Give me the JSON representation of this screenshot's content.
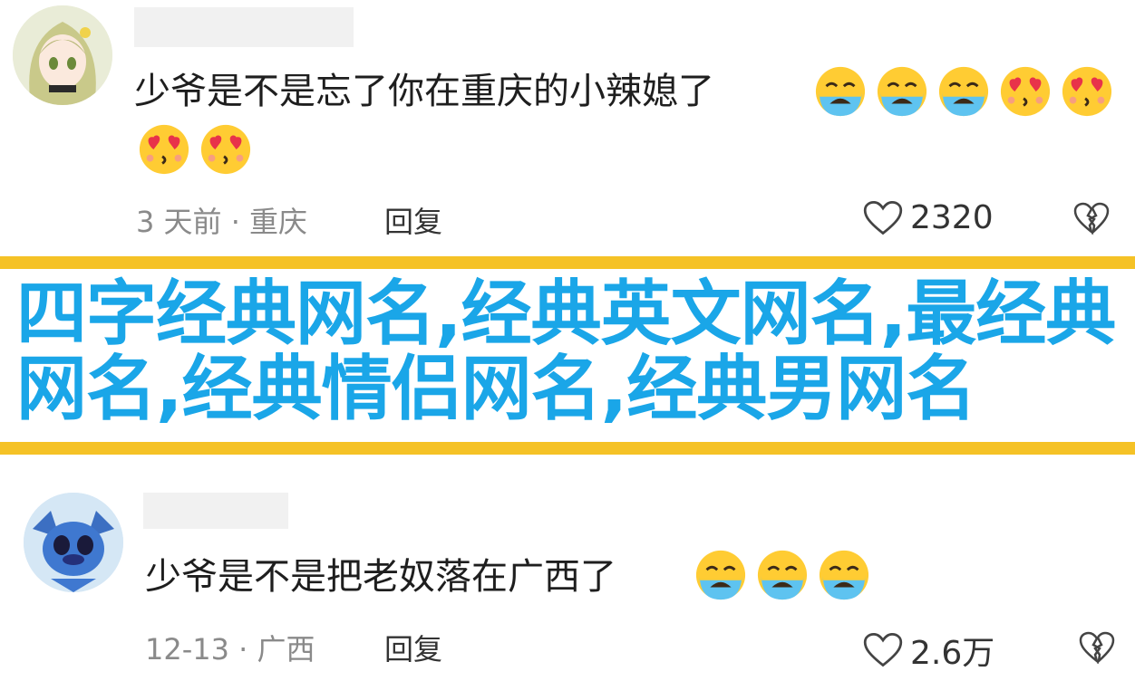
{
  "comments": [
    {
      "text": "少爷是不是忘了你在重庆的小辣媳了",
      "emojis": [
        "crying-face",
        "crying-face",
        "crying-face",
        "heart-eyes-face",
        "heart-eyes-face",
        "heart-eyes-face",
        "heart-eyes-face"
      ],
      "meta": "3 天前 · 重庆",
      "reply_label": "回复",
      "like_count": "2320"
    },
    {
      "text": "少爷是不是把老奴落在广西了",
      "emojis": [
        "crying-face",
        "crying-face",
        "crying-face"
      ],
      "meta": "12-13 · 广西",
      "reply_label": "回复",
      "like_count": "2.6万"
    }
  ],
  "banner": {
    "title": "四字经典网名,经典英文网名,最经典网名,经典情侣网名,经典男网名"
  },
  "colors": {
    "banner_text": "#1aa6e8",
    "stripe": "#f5c226",
    "meta_text": "#8a8a8a"
  }
}
